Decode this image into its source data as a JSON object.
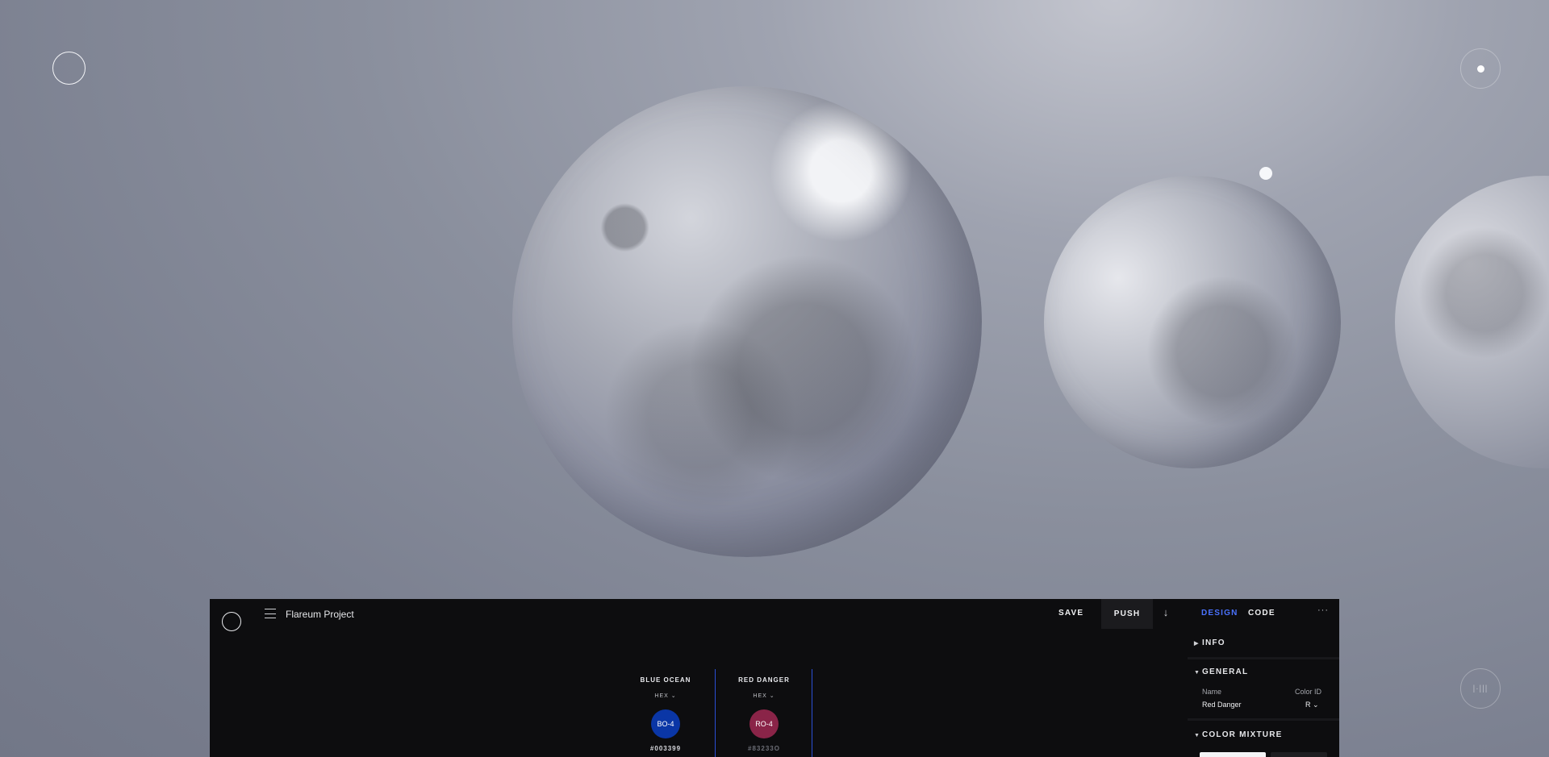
{
  "header": {
    "project_title": "Flareum Project",
    "save_label": "SAVE",
    "push_label": "PUSH"
  },
  "colors": [
    {
      "name": "BLUE OCEAN",
      "format": "HEX ⌄",
      "code": "BO-4",
      "hex": "#003399",
      "swatch_color": "#0a36a6"
    },
    {
      "name": "RED DANGER",
      "format": "HEX ⌄",
      "code": "RO-4",
      "hex": "#83233O",
      "swatch_color": "#8a2448"
    }
  ],
  "side_panel": {
    "tabs": {
      "design": "DESIGN",
      "code": "CODE"
    },
    "sections": {
      "info": "INFO",
      "general": "GENERAL",
      "color_mixture": "COLOR MIXTURE"
    },
    "general": {
      "name_label": "Name",
      "name_value": "Red Danger",
      "color_id_label": "Color ID",
      "color_id_value": "R ⌄"
    }
  },
  "icons": {
    "top_left": "ring-icon",
    "top_right": "dot-ring-icon",
    "bottom_right": "audio-ring-icon",
    "menu": "hamburger-icon",
    "download": "arrow-down-icon",
    "more": "ellipsis-icon"
  },
  "accent_color": "#4a72ff"
}
